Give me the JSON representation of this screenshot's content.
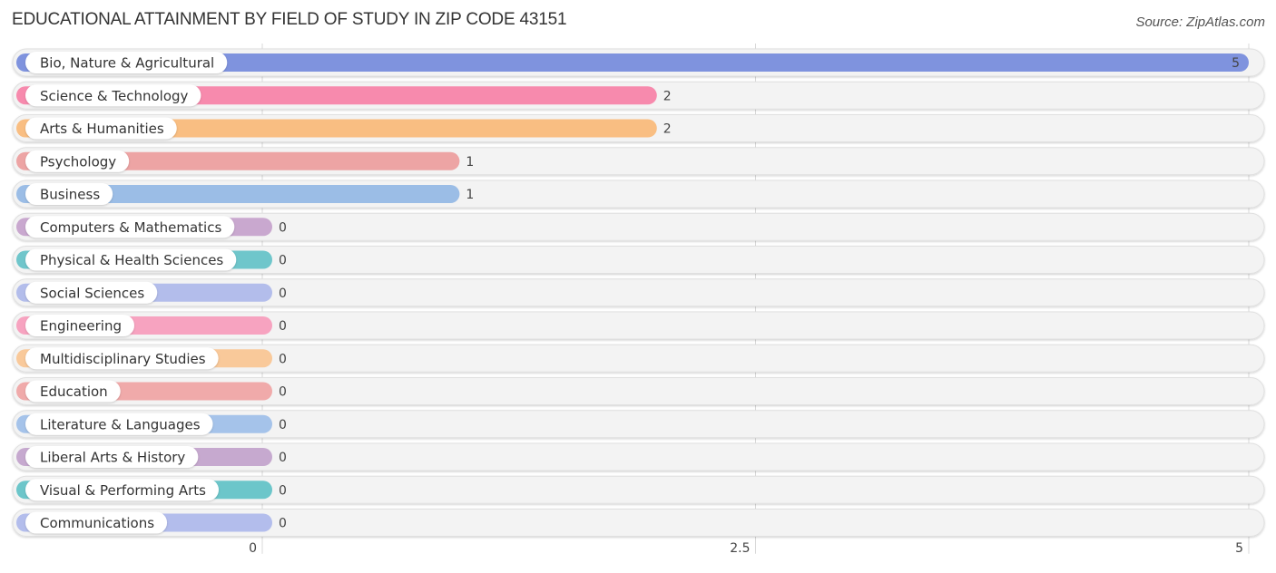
{
  "title": "EDUCATIONAL ATTAINMENT BY FIELD OF STUDY IN ZIP CODE 43151",
  "source": "Source: ZipAtlas.com",
  "chart_data": {
    "type": "bar",
    "orientation": "horizontal",
    "title": "EDUCATIONAL ATTAINMENT BY FIELD OF STUDY IN ZIP CODE 43151",
    "xlabel": "",
    "ylabel": "",
    "xlim": [
      0,
      5
    ],
    "xticks": [
      0,
      2.5,
      5
    ],
    "xtick_labels": [
      "0",
      "2.5",
      "5"
    ],
    "grid": true,
    "categories": [
      "Bio, Nature & Agricultural",
      "Science & Technology",
      "Arts & Humanities",
      "Psychology",
      "Business",
      "Computers & Mathematics",
      "Physical & Health Sciences",
      "Social Sciences",
      "Engineering",
      "Multidisciplinary Studies",
      "Education",
      "Literature & Languages",
      "Liberal Arts & History",
      "Visual & Performing Arts",
      "Communications"
    ],
    "values": [
      5,
      2,
      2,
      1,
      1,
      0,
      0,
      0,
      0,
      0,
      0,
      0,
      0,
      0,
      0
    ],
    "value_labels": [
      "5",
      "2",
      "2",
      "1",
      "1",
      "0",
      "0",
      "0",
      "0",
      "0",
      "0",
      "0",
      "0",
      "0",
      "0"
    ],
    "colors": [
      "#7f93de",
      "#f78aad",
      "#f9be82",
      "#eda4a4",
      "#9bbde6",
      "#c9a8cf",
      "#6fc6cb",
      "#b3bdeb",
      "#f7a3c0",
      "#f9c99a",
      "#f0aaaa",
      "#a5c3ea",
      "#c6a9cf",
      "#6cc6ca",
      "#b3bdec"
    ]
  }
}
